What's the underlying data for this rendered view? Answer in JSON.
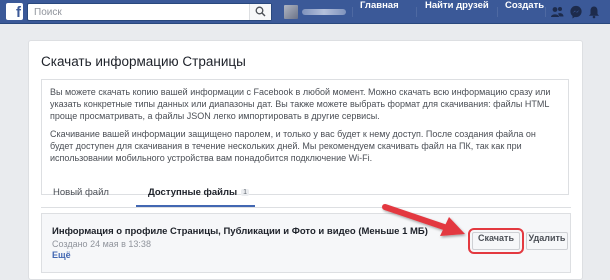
{
  "topbar": {
    "logo": "f",
    "search_placeholder": "Поиск",
    "nav": {
      "home": "Главная",
      "find_friends": "Найти друзей",
      "create": "Создать"
    }
  },
  "page": {
    "title": "Скачать информацию Страницы",
    "info_paragraph_1": "Вы можете скачать копию вашей информации с Facebook в любой момент. Можно скачать всю информацию сразу или указать конкретные типы данных или диапазоны дат. Вы также можете выбрать формат для скачивания: файлы HTML проще просматривать, а файлы JSON легко импортировать в другие сервисы.",
    "info_paragraph_2": "Скачивание вашей информации защищено паролем, и только у вас будет к нему доступ. После создания файла он будет доступен для скачивания в течение нескольких дней. Мы рекомендуем скачивать файл на ПК, так как при использовании мобильного устройства вам понадобится подключение Wi-Fi."
  },
  "tabs": {
    "new_file": "Новый файл",
    "available_files": "Доступные файлы",
    "available_count": "1"
  },
  "file": {
    "title": "Информация о профиле Страницы, Публикации и Фото и видео (Меньше 1 МБ)",
    "created": "Создано 24 мая в 13:38",
    "more": "Ещё",
    "download_label": "Скачать",
    "delete_label": "Удалить"
  },
  "colors": {
    "brand": "#3b5998",
    "highlight": "#e33940"
  }
}
